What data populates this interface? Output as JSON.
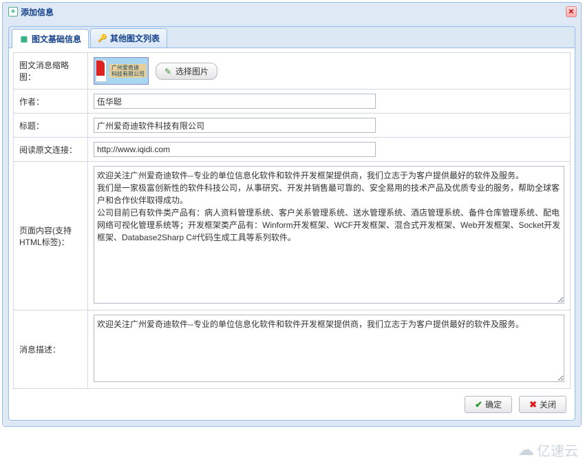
{
  "window": {
    "title": "添加信息",
    "close_tooltip": "关闭"
  },
  "tabs": [
    {
      "label": "图文基础信息",
      "active": true
    },
    {
      "label": "其他图文列表",
      "active": false
    }
  ],
  "form": {
    "thumbnail": {
      "label": "图文消息缩略图：",
      "button": "选择图片"
    },
    "author": {
      "label": "作者：",
      "value": "伍华聪"
    },
    "title": {
      "label": "标题：",
      "value": "广州爱奇迪软件科技有限公司"
    },
    "source_url": {
      "label": "阅读原文连接：",
      "value": "http://www.iqidi.com"
    },
    "content": {
      "label": "页面内容(支持HTML标签)：",
      "value": "欢迎关注广州爱奇迪软件--专业的单位信息化软件和软件开发框架提供商，我们立志于为客户提供最好的软件及服务。\n我们是一家极富创新性的软件科技公司，从事研究、开发并销售最可靠的、安全易用的技术产品及优质专业的服务，帮助全球客户和合作伙伴取得成功。\n公司目前已有软件类产品有：病人资料管理系统、客户关系管理系统、送水管理系统、酒店管理系统、备件仓库管理系统、配电网络可视化管理系统等；开发框架类产品有：Winform开发框架、WCF开发框架、混合式开发框架、Web开发框架、Socket开发框架、Database2Sharp C#代码生成工具等系列软件。"
    },
    "description": {
      "label": "消息描述：",
      "value": "欢迎关注广州爱奇迪软件--专业的单位信息化软件和软件开发框架提供商，我们立志于为客户提供最好的软件及服务。"
    }
  },
  "buttons": {
    "ok": "确定",
    "close": "关闭"
  },
  "watermark": "亿速云"
}
